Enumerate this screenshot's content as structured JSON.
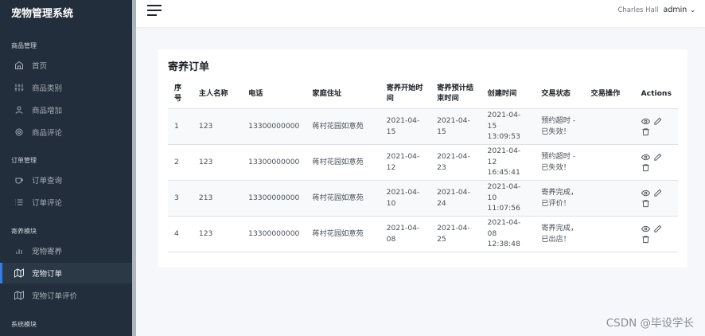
{
  "brand": "宠物管理系统",
  "sidebar": {
    "sections": [
      {
        "header": "商品管理",
        "items": [
          {
            "label": "首页",
            "icon": "home-icon"
          },
          {
            "label": "商品类别",
            "icon": "sliders-icon"
          },
          {
            "label": "商品增加",
            "icon": "user-icon"
          },
          {
            "label": "商品评论",
            "icon": "settings-icon"
          }
        ]
      },
      {
        "header": "订单管理",
        "items": [
          {
            "label": "订单查询",
            "icon": "coffee-icon"
          },
          {
            "label": "订单评论",
            "icon": "list-icon"
          }
        ]
      },
      {
        "header": "寄养模块",
        "items": [
          {
            "label": "宠物寄养",
            "icon": "bar-chart-icon"
          },
          {
            "label": "宠物订单",
            "icon": "map-icon",
            "active": true
          },
          {
            "label": "宠物订单评价",
            "icon": "map-icon"
          }
        ]
      },
      {
        "header": "系统模块",
        "items": []
      }
    ]
  },
  "topbar": {
    "avatar_alt": "Charles Hall",
    "username": "admin",
    "caret": "⌄"
  },
  "card": {
    "title": "寄养订单",
    "columns": [
      "序号",
      "主人名称",
      "电话",
      "家庭住址",
      "寄养开始时间",
      "寄养预计结束时间",
      "创建时间",
      "交易状态",
      "交易操作",
      "Actions"
    ],
    "rows": [
      {
        "no": "1",
        "owner": "123",
        "phone": "13300000000",
        "address": "蒋村花园如意苑",
        "start": "2021-04-15",
        "end": "2021-04-15",
        "created": "2021-04-15 13:09:53",
        "status": "预约超时 - 已失效！",
        "op": ""
      },
      {
        "no": "2",
        "owner": "123",
        "phone": "13300000000",
        "address": "蒋村花园如意苑",
        "start": "2021-04-12",
        "end": "2021-04-23",
        "created": "2021-04-12 16:45:41",
        "status": "预约超时 - 已失效！",
        "op": ""
      },
      {
        "no": "3",
        "owner": "213",
        "phone": "13300000000",
        "address": "蒋村花园如意苑",
        "start": "2021-04-10",
        "end": "2021-04-24",
        "created": "2021-04-10 11:07:56",
        "status": "寄养完成，已评价！",
        "op": ""
      },
      {
        "no": "4",
        "owner": "123",
        "phone": "13300000000",
        "address": "蒋村花园如意苑",
        "start": "2021-04-08",
        "end": "2021-04-25",
        "created": "2021-04-08 12:38:48",
        "status": "寄养完成，已出店！",
        "op": ""
      }
    ]
  },
  "watermark": "CSDN @毕设学长",
  "colors": {
    "sidebar_bg": "#222e3c",
    "accent": "#3b7ddd",
    "page_bg": "#f5f7fb"
  }
}
